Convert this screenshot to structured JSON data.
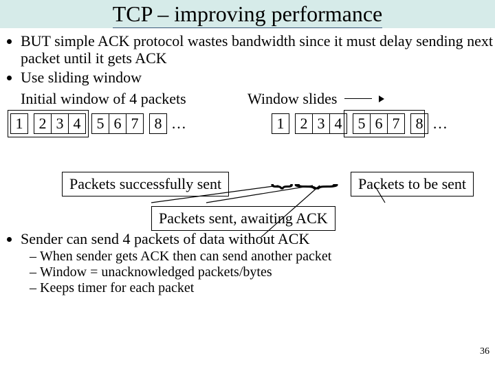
{
  "title": "TCP – improving performance",
  "bullets_top": [
    "BUT simple ACK protocol wastes bandwidth since it must delay sending next packet until it gets ACK",
    "Use sliding window"
  ],
  "label_initial": "Initial window of 4 packets",
  "label_slides": "Window slides",
  "packets_left": [
    "1",
    "2",
    "3",
    "4",
    "5",
    "6",
    "7",
    "8"
  ],
  "packets_right": [
    "1",
    "2",
    "3",
    "4",
    "5",
    "6",
    "7",
    "8"
  ],
  "ellipsis": "…",
  "box_sent": "Packets successfully sent",
  "box_tobesent": "Packets to be sent",
  "box_awaiting": "Packets sent, awaiting ACK",
  "bullets_bottom_lead": "Sender can send 4 packets of data without ACK",
  "bullets_bottom_sub": [
    "When sender gets ACK then can send another packet",
    "Window = unacknowledged packets/bytes",
    "Keeps timer for each packet"
  ],
  "pagenum": "36"
}
